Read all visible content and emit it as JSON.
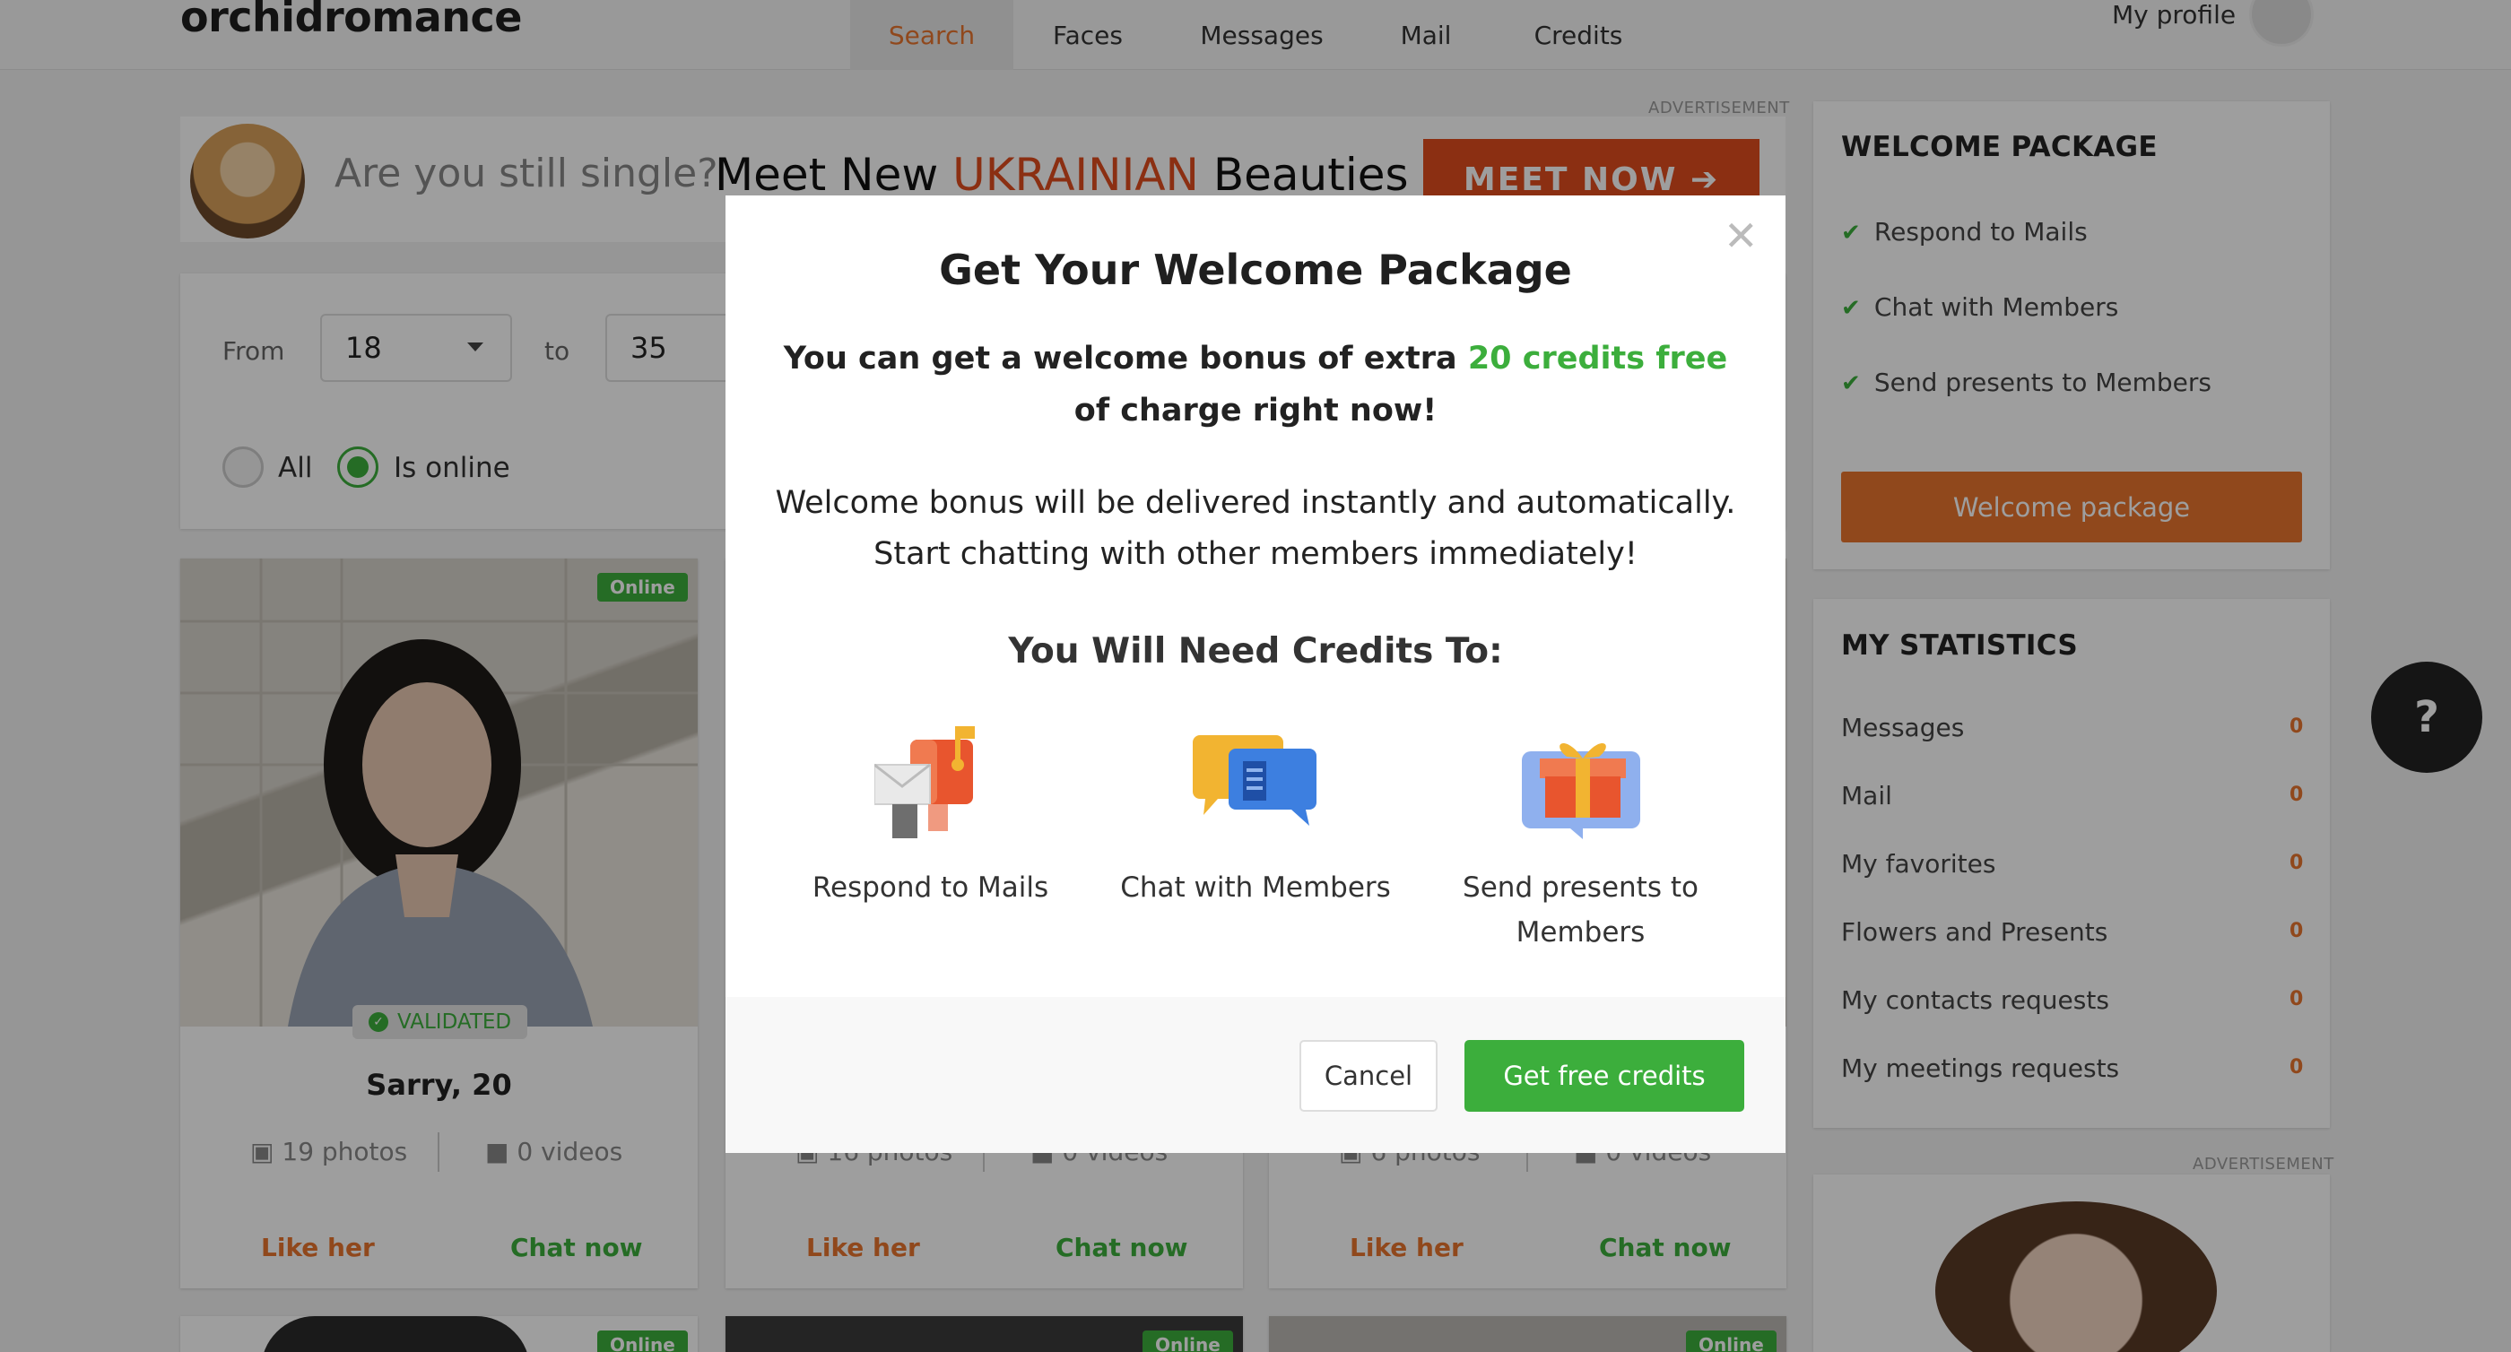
{
  "header": {
    "logo": "orchidromance",
    "nav": [
      "Search",
      "Faces",
      "Messages",
      "Mail",
      "Credits"
    ],
    "profile_label": "My profile"
  },
  "banner": {
    "ad_label": "ADVERTISEMENT",
    "question": "Are you still single?",
    "main_prefix": "Meet New",
    "main_highlight": "UKRAINIAN",
    "main_suffix": "Beauties",
    "cta": "MEET NOW ➔",
    "accent": "#e04d1e"
  },
  "filter": {
    "from_label": "From",
    "from_value": "18",
    "to_label": "to",
    "to_value": "35",
    "radio_all": "All",
    "radio_online": "Is online"
  },
  "cards": [
    {
      "online": "Online",
      "validated": "VALIDATED",
      "name": "Sarry, 20",
      "photos": "19 photos",
      "videos": "0 videos",
      "like": "Like her",
      "chat": "Chat now"
    },
    {
      "photos": "16 photos",
      "videos": "0 videos",
      "like": "Like her",
      "chat": "Chat now"
    },
    {
      "photos": "6 photos",
      "videos": "0 videos",
      "like": "Like her",
      "chat": "Chat now"
    }
  ],
  "row2_online": "Online",
  "welcome_package": {
    "title": "WELCOME PACKAGE",
    "items": [
      "Respond to Mails",
      "Chat with Members",
      "Send presents to Members"
    ],
    "button": "Welcome package"
  },
  "statistics": {
    "title": "MY STATISTICS",
    "rows": [
      {
        "label": "Messages",
        "value": "0"
      },
      {
        "label": "Mail",
        "value": "0"
      },
      {
        "label": "My favorites",
        "value": "0"
      },
      {
        "label": "Flowers and Presents",
        "value": "0"
      },
      {
        "label": "My contacts requests",
        "value": "0"
      },
      {
        "label": "My meetings requests",
        "value": "0"
      }
    ]
  },
  "side_ad_label": "ADVERTISEMENT",
  "help": "?",
  "modal": {
    "title": "Get Your Welcome Package",
    "bonus_prefix": "You can get a welcome bonus of extra",
    "bonus_highlight": "20 credits free",
    "bonus_suffix": "of charge right now!",
    "body_line1": "Welcome bonus will be delivered instantly and automatically.",
    "body_line2": "Start chatting with other members immediately!",
    "need_title": "You Will Need Credits To:",
    "features": [
      {
        "icon": "mailbox-icon",
        "label": "Respond to Mails"
      },
      {
        "icon": "chat-bubbles-icon",
        "label": "Chat with Members"
      },
      {
        "icon": "gift-icon",
        "label_line1": "Send presents to",
        "label_line2": "Members"
      }
    ],
    "cancel": "Cancel",
    "confirm": "Get free credits",
    "green": "#3cae3c"
  }
}
